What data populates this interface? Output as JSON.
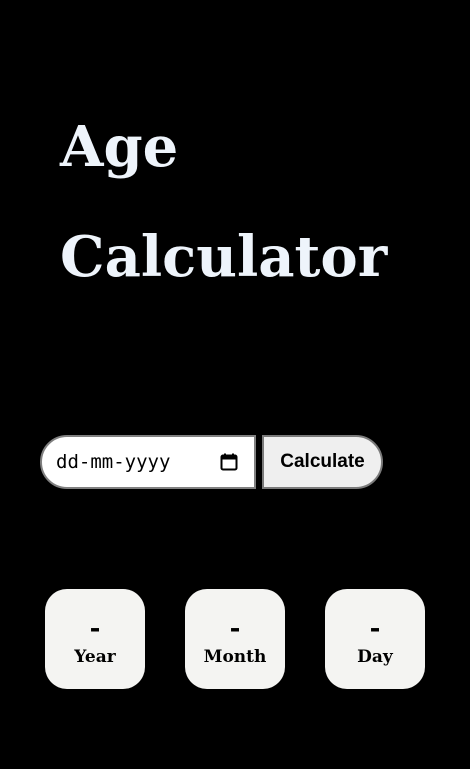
{
  "header": {
    "title_line1": "Age",
    "title_line2": "Calculator"
  },
  "form": {
    "date_placeholder": "dd-mm-yyyy",
    "calendar_icon": "calendar-icon",
    "calculate_label": "Calculate"
  },
  "results": [
    {
      "value": "-",
      "label": "Year"
    },
    {
      "value": "-",
      "label": "Month"
    },
    {
      "value": "-",
      "label": "Day"
    }
  ],
  "colors": {
    "background": "#000000",
    "title": "#eef4fb",
    "card": "#f4f4f2",
    "button": "#efefef"
  }
}
